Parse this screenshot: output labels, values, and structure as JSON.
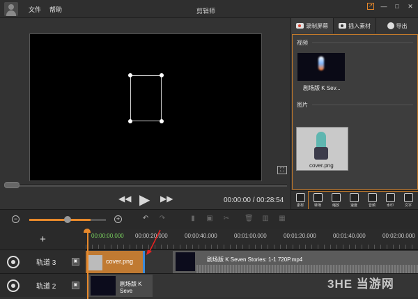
{
  "titlebar": {
    "title": "剪辑师",
    "menu": {
      "file": "文件",
      "help": "帮助"
    },
    "window_buttons": {
      "minimize": "—",
      "maximize": "□",
      "close": "✕"
    }
  },
  "preview": {
    "timecode": "00:00:00 / 00:28:54",
    "transport": {
      "rewind": "◀◀",
      "play": "▶",
      "forward": "▶▶"
    },
    "progress": 0.0
  },
  "right_panel": {
    "tabs": [
      {
        "label": "录制屏幕",
        "icon": "record-icon"
      },
      {
        "label": "插入素材",
        "icon": "camera-icon"
      },
      {
        "label": "导出",
        "icon": "reel-icon"
      }
    ],
    "sections": {
      "video": "视频",
      "image": "图片"
    },
    "video_item": "剧场版 K Sev...",
    "image_item": "cover.png",
    "tools": [
      {
        "label": "素材",
        "icon": "folder-icon"
      },
      {
        "label": "转场",
        "icon": "transition-icon"
      },
      {
        "label": "缩放",
        "icon": "zoom-icon"
      },
      {
        "label": "速度",
        "icon": "speed-icon"
      },
      {
        "label": "音频",
        "icon": "audio-icon"
      },
      {
        "label": "水印",
        "icon": "watermark-icon"
      },
      {
        "label": "文字",
        "icon": "text-icon"
      }
    ]
  },
  "timeline": {
    "add_label": "+",
    "ruler": [
      "00:00:00.000",
      "00:00:20.000",
      "00:00:40.000",
      "00:01:00.000",
      "00:01:20.000",
      "00:01:40.000",
      "00:02:00.000"
    ],
    "zoom_level": 0.8,
    "tracks": [
      {
        "label": "轨道 3",
        "lock": "🔒"
      },
      {
        "label": "轨道 2",
        "lock": "🔒"
      }
    ],
    "clips": {
      "cover": "cover.png",
      "video_main": "剧场版 K Seven Stories: 1-1 720P.mp4",
      "video_track2": "剧场版 K Seve"
    }
  },
  "watermark": "3HE 当游网"
}
